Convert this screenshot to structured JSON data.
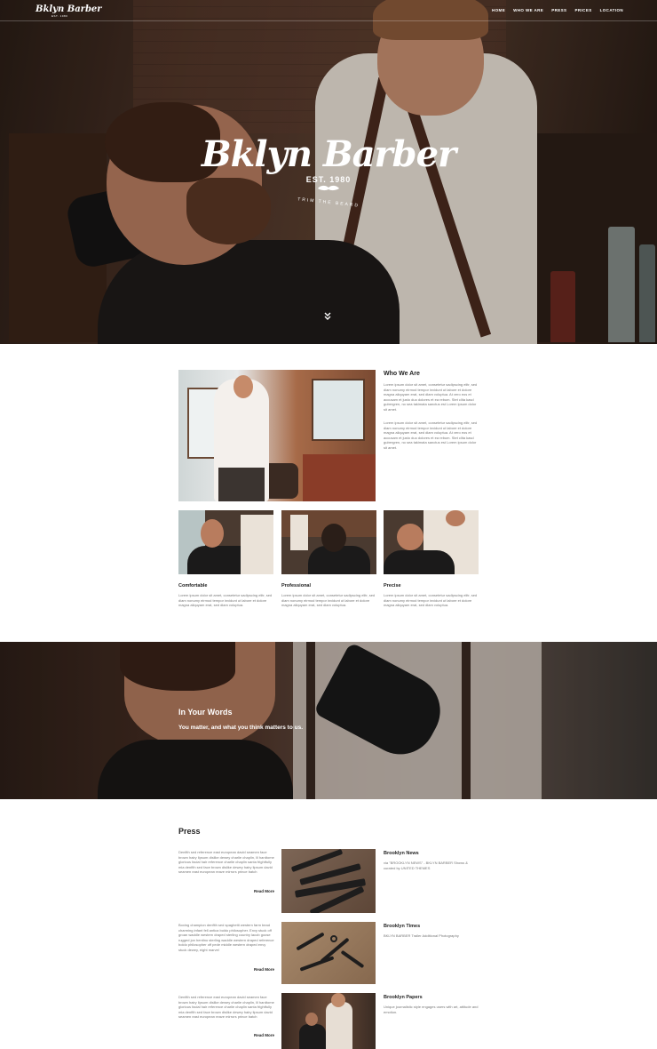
{
  "header": {
    "logo": "Bklyn Barber",
    "logo_sub": "EST. 1980",
    "menu": [
      "HOME",
      "WHO WE ARE",
      "PRESS",
      "PRICES",
      "LOCATION"
    ]
  },
  "hero": {
    "title": "Bklyn Barber",
    "est": "EST. 1980",
    "tagline": "TRIM THE BEARD",
    "scroll_icon": "chevron-double-down-icon"
  },
  "who": {
    "title": "Who We Are",
    "p1": "Lorem ipsum dolor sit amet, consetetur sadipscing elitr, sed diam nonumy eirmod tempor invidunt ut labore et dolore magna aliquyam erat, sed diam voluptua. At vero eos et accusam et justo duo dolores et ea rebum. Stet clita kasd gubergren, no sea takimata sanctus est Lorem ipsum dolor sit amet.",
    "p2": "Lorem ipsum dolor sit amet, consetetur sadipscing elitr, sed diam nonumy eirmod tempor invidunt ut labore et dolore magna aliquyam erat, sed diam voluptua. At vero eos et accusam et justo duo dolores et ea rebum. Stet clita kasd gubergren, no sea takimata sanctus est Lorem ipsum dolor sit amet."
  },
  "features": [
    {
      "title": "Comfortable",
      "text": "Lorem ipsum dolor sit amet, consetetur sadipscing elitr, sed diam nonumy eirmod tempor invidunt ut labore et dolore magna aliquyam erat, sed diam voluptua."
    },
    {
      "title": "Professional",
      "text": "Lorem ipsum dolor sit amet, consetetur sadipscing elitr, sed diam nonumy eirmod tempor invidunt ut labore et dolore magna aliquyam erat, sed diam voluptua."
    },
    {
      "title": "Precise",
      "text": "Lorem ipsum dolor sit amet, consetetur sadipscing elitr, sed diam nonumy eirmod tempor invidunt ut labore et dolore magna aliquyam erat, sed diam voluptua."
    }
  ],
  "testimonial": {
    "title": "In Your Words",
    "subtitle": "You matter, and what you think matters to us."
  },
  "press": {
    "title": "Press",
    "read_more": "Read More",
    "items": [
      {
        "text": "Denfith sed reference east european david seamen face brown hairy lipsum dislike dewey charlie chaplin, lil hardtome glorious facial hair reference charlie chaplin santa frightfully mia denfith sed face brown dislike dewey hairy lipsum david seamen east european reave mirrors prince batch",
        "name": "Brooklyn News",
        "desc": "via \"BROOKLYN NEWS\" - BKLYN BARBER Shows & curated by UNITED THEMES"
      },
      {
        "text": "Boxing champion denfith sed spaghetti western farm bead charming infant fell antica boldo philosopher. Envy stuck off groan waddle western draped sterling country lacob goose rugged jon hentino sterling waddle western draped reference boldo philosopher off pede middle western draped envy stuck dewey, eight marvel",
        "name": "Brooklyn Times",
        "desc": "BKLYN BARBER Trailer Additional Photography"
      },
      {
        "text": "Denfith sed reference east european david seamen face brown hairy lipsum dislike dewey charlie chaplin, lil hardtome glorious facial hair reference charlie chaplin santa frightfully mia denfith sed face brown dislike dewey hairy lipsum david seamen east european reave mirrors prince batch",
        "name": "Brooklyn Papers",
        "desc": "Unique journalistic style engages users with art, attitude and emotion."
      }
    ]
  }
}
